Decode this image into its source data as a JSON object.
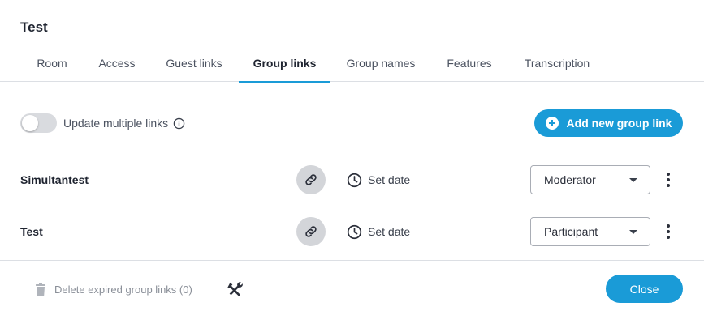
{
  "dialog": {
    "title": "Test"
  },
  "tabs": [
    {
      "label": "Room"
    },
    {
      "label": "Access"
    },
    {
      "label": "Guest links"
    },
    {
      "label": "Group links",
      "active": true
    },
    {
      "label": "Group names"
    },
    {
      "label": "Features"
    },
    {
      "label": "Transcription"
    }
  ],
  "toolbar": {
    "toggle_label": "Update multiple links",
    "toggle_on": false,
    "add_button_label": "Add new group link"
  },
  "group_links": [
    {
      "name": "Simultantest",
      "date_label": "Set date",
      "role": "Moderator"
    },
    {
      "name": "Test",
      "date_label": "Set date",
      "role": "Participant"
    }
  ],
  "footer": {
    "delete_expired_label": "Delete expired group links (0)",
    "close_label": "Close"
  },
  "colors": {
    "accent": "#1a9bd7",
    "toggle_off": "#d9dbdf",
    "link_button_bg": "#d3d5d9",
    "disabled_text": "#8a8f98"
  },
  "icons": {
    "info": "info-icon",
    "plus": "plus-circle-icon",
    "link": "link-icon",
    "clock": "clock-icon",
    "caret": "caret-down-icon",
    "kebab": "kebab-menu-icon",
    "trash": "trash-icon",
    "tools": "hammer-wrench-icon"
  }
}
